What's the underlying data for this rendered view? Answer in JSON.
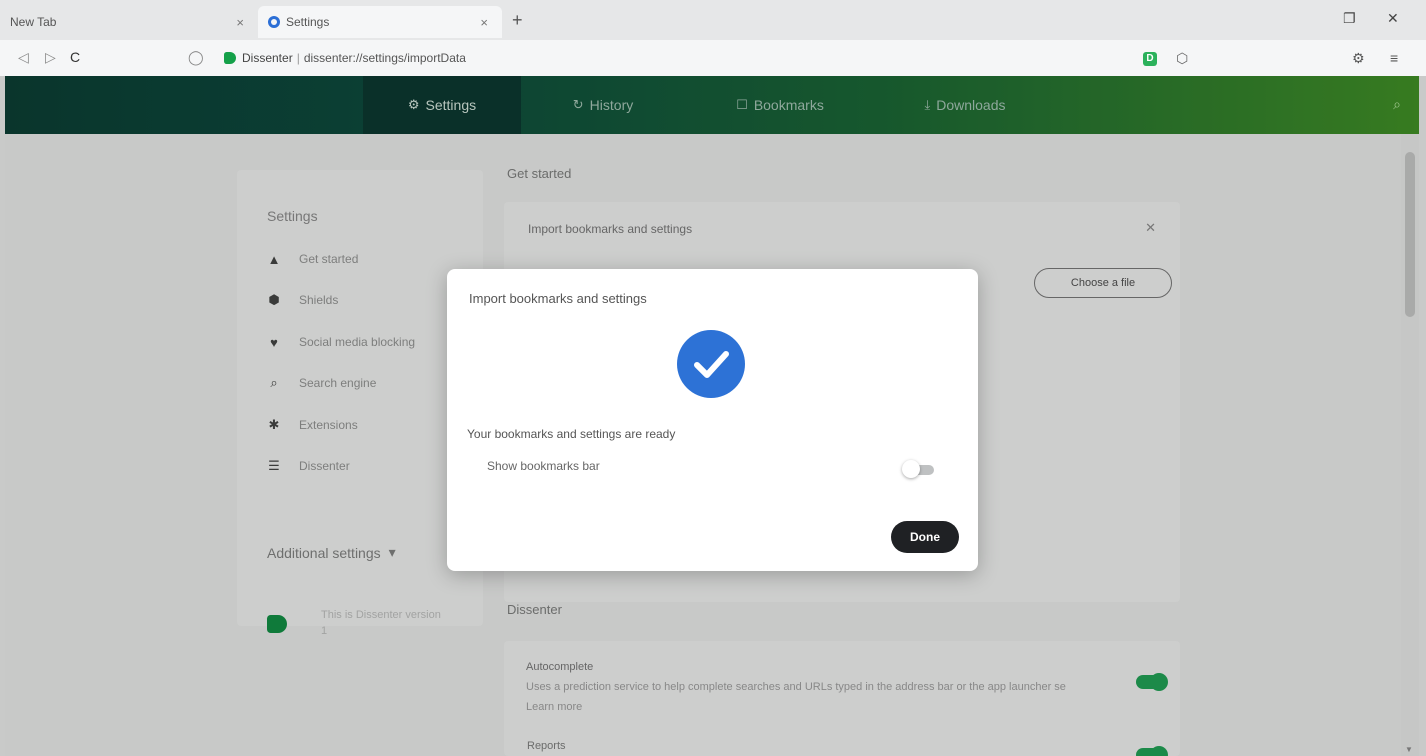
{
  "browser": {
    "tabs": [
      {
        "title": "New Tab",
        "close": "×"
      },
      {
        "title": "Settings",
        "close": "×"
      }
    ],
    "new_tab": "+",
    "window_controls": {
      "restore": "❐",
      "close": "✕"
    },
    "nav": {
      "back": "◁",
      "forward": "▷",
      "reload": "C",
      "home": "◯"
    },
    "site_name": "Dissenter",
    "url_path": "dissenter://settings/importData",
    "extension_badge": "D",
    "icons": [
      "site-icon",
      "shield-icon",
      "settings-gear-icon",
      "menu-icon"
    ]
  },
  "app_header": {
    "tabs": [
      {
        "label": "Settings",
        "icon": "⚙"
      },
      {
        "label": "History",
        "icon": "↻"
      },
      {
        "label": "Bookmarks",
        "icon": "☐"
      },
      {
        "label": "Downloads",
        "icon": "⤓"
      }
    ],
    "right_icon": "⌕"
  },
  "sidebar": {
    "title": "Settings",
    "items": [
      {
        "label": "Get started",
        "icon": "▲"
      },
      {
        "label": "Shields",
        "icon": "⬢"
      },
      {
        "label": "Social media blocking",
        "icon": "♥"
      },
      {
        "label": "Search engine",
        "icon": "⌕"
      },
      {
        "label": "Extensions",
        "icon": "✱"
      },
      {
        "label": "Dissenter",
        "icon": "☰"
      }
    ],
    "additional_settings": "Additional settings",
    "additional_chevron": "▾",
    "promo_text": "This is Dissenter version 1"
  },
  "main": {
    "get_started_heading": "Get started",
    "import_row_label": "Import bookmarks and settings",
    "import_row_x": "✕",
    "choose_file_label": "Choose a file",
    "privacy_heading": "Dissenter",
    "privacy": {
      "title": "Autocomplete",
      "description": "Uses a prediction service to help complete searches and URLs typed in the address bar or the app launcher search box",
      "link": "Learn more",
      "title2": "Reports"
    }
  },
  "modal": {
    "title": "Import bookmarks and settings",
    "message": "Your bookmarks and settings are ready",
    "toggle_label": "Show bookmarks bar",
    "toggle_state": false,
    "done_label": "Done",
    "accent": "#2d72d6"
  },
  "colors": {
    "header_start": "#0c3d33",
    "header_end": "#3f8c25",
    "toggle_on": "#1c8a49",
    "button_dark": "#1f2124"
  }
}
